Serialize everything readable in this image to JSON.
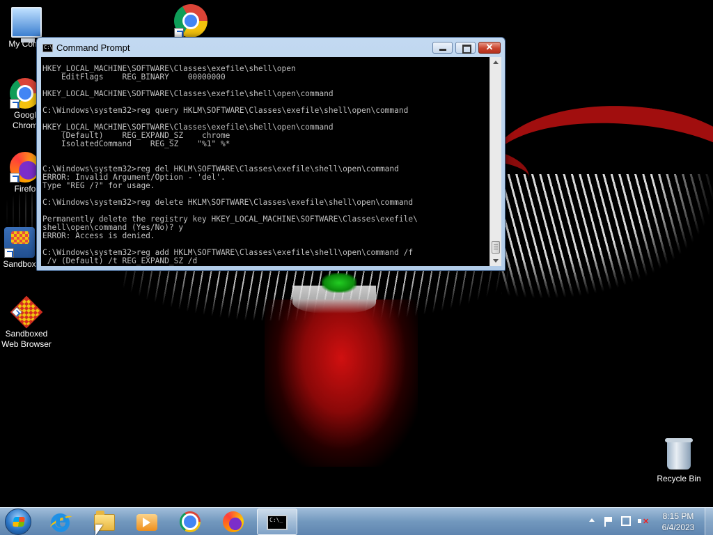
{
  "desktop": {
    "icons": [
      {
        "id": "my-computer",
        "label": "My Comp",
        "icon": "computer-icon"
      },
      {
        "id": "chrome-top",
        "label": "",
        "icon": "chrome-icon"
      },
      {
        "id": "google-chrome",
        "label": "Googl\nChrom",
        "icon": "chrome-icon"
      },
      {
        "id": "firefox",
        "label": "Firefo",
        "icon": "firefox-icon"
      },
      {
        "id": "sandboxie",
        "label": "Sandbox",
        "icon": "sandboxie-icon"
      },
      {
        "id": "sandboxed-web-browser",
        "label": "Sandboxed\nWeb Browser",
        "icon": "sandboxie-icon"
      },
      {
        "id": "recycle-bin",
        "label": "Recycle Bin",
        "icon": "recycle-bin-icon"
      }
    ]
  },
  "cmd_window": {
    "title": "Command Prompt",
    "icon": "cmd-icon",
    "controls": {
      "minimize": "minimize",
      "maximize": "maximize",
      "close": "✕"
    },
    "console_text": "HKEY_LOCAL_MACHINE\\SOFTWARE\\Classes\\exefile\\shell\\open\n    EditFlags    REG_BINARY    00000000\n\nHKEY_LOCAL_MACHINE\\SOFTWARE\\Classes\\exefile\\shell\\open\\command\n\nC:\\Windows\\system32>reg query HKLM\\SOFTWARE\\Classes\\exefile\\shell\\open\\command\n\nHKEY_LOCAL_MACHINE\\SOFTWARE\\Classes\\exefile\\shell\\open\\command\n    (Default)    REG_EXPAND_SZ    chrome\n    IsolatedCommand    REG_SZ    \"%1\" %*\n\n\nC:\\Windows\\system32>reg del HKLM\\SOFTWARE\\Classes\\exefile\\shell\\open\\command\nERROR: Invalid Argument/Option - 'del'.\nType \"REG /?\" for usage.\n\nC:\\Windows\\system32>reg delete HKLM\\SOFTWARE\\Classes\\exefile\\shell\\open\\command\n\nPermanently delete the registry key HKEY_LOCAL_MACHINE\\SOFTWARE\\Classes\\exefile\\\nshell\\open\\command (Yes/No)? y\nERROR: Access is denied.\n\nC:\\Windows\\system32>reg add HKLM\\SOFTWARE\\Classes\\exefile\\shell\\open\\command /f\n /v (Default) /t REG_EXPAND_SZ /d"
  },
  "taskbar": {
    "start": "start-orb-icon",
    "pinned": [
      {
        "id": "ie",
        "icon": "internet-explorer-icon"
      },
      {
        "id": "explorer",
        "icon": "folder-icon"
      },
      {
        "id": "media-player",
        "icon": "media-player-icon"
      },
      {
        "id": "chrome",
        "icon": "chrome-icon"
      },
      {
        "id": "firefox",
        "icon": "firefox-icon"
      },
      {
        "id": "cmd",
        "icon": "cmd-icon",
        "active": true
      }
    ],
    "tray": {
      "icons": [
        "show-hidden-icons-chevron",
        "action-center-flag-icon",
        "network-icon",
        "volume-muted-icon"
      ],
      "time": "8:15 PM",
      "date": "6/4/2023"
    }
  }
}
